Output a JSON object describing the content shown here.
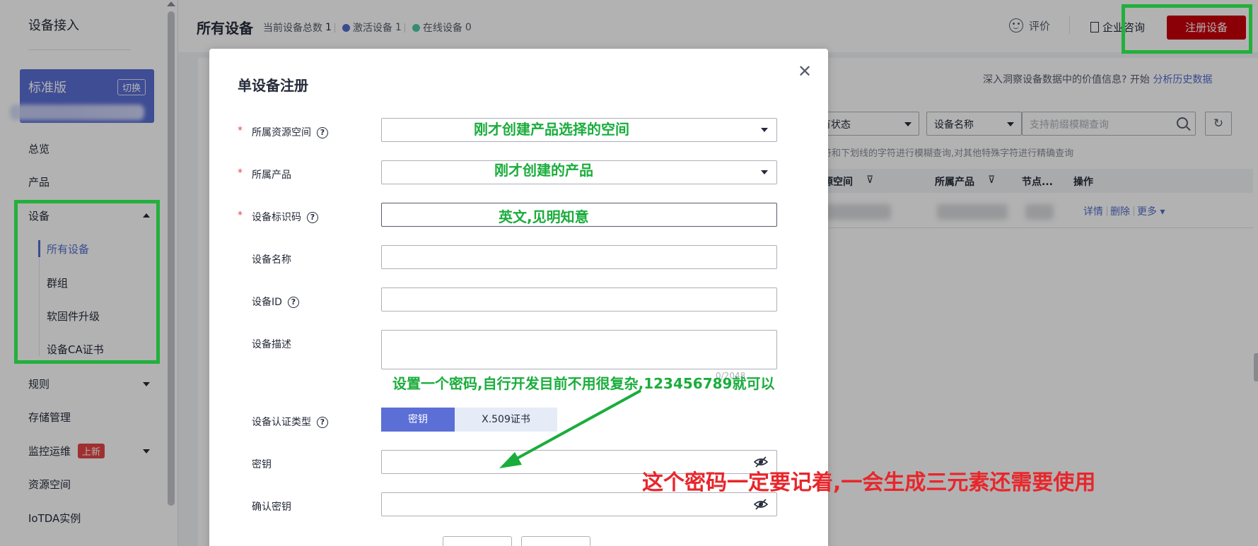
{
  "sidebar": {
    "brand": "设备接入",
    "edition": "标准版",
    "switch_label": "切换",
    "items": {
      "overview": "总览",
      "product": "产品",
      "device": "设备",
      "all_devices": "所有设备",
      "group": "群组",
      "firmware": "软固件升级",
      "ca_cert": "设备CA证书",
      "rules": "规则",
      "storage": "存储管理",
      "monitor": "监控运维",
      "monitor_badge": "上新",
      "resource_space": "资源空间",
      "iotda_instance": "IoTDA实例"
    }
  },
  "header": {
    "title": "所有设备",
    "total_label": "当前设备总数",
    "total_value": "1",
    "active_label": "激活设备",
    "active_value": "1",
    "online_label": "在线设备",
    "online_value": "0",
    "rate_label": "评价",
    "consult_label": "企业咨询",
    "register_button": "注册设备",
    "colors": {
      "active_dot": "#526ecc",
      "online_dot": "#50c8a8",
      "brand_red": "#c7000b"
    }
  },
  "content": {
    "insight_text": "深入洞察设备数据中的价值信息? 开始",
    "insight_link": "分析历史数据",
    "status_filter": "有状态",
    "name_filter": "设备名称",
    "search_placeholder": "支持前缀模糊查询",
    "hint_text": "字符和下划线的字符进行模糊查询,对其他特殊字符进行精确查询",
    "columns": {
      "resource_space": "资源空间",
      "product": "所属产品",
      "node": "节点...",
      "operations": "操作"
    },
    "row_ops": {
      "detail": "详情",
      "delete": "删除",
      "more": "更多"
    }
  },
  "modal": {
    "title": "单设备注册",
    "fields": {
      "resource_space": "所属资源空间",
      "product": "所属产品",
      "node_id": "设备标识码",
      "device_name": "设备名称",
      "device_id": "设备ID",
      "description": "设备描述",
      "auth_type": "设备认证类型",
      "secret": "密钥",
      "confirm_secret": "确认密钥"
    },
    "description_counter": "0/2048",
    "auth_options": {
      "secret": "密钥",
      "x509": "X.509证书"
    }
  },
  "annotations": {
    "resource_space_note": "刚才创建产品选择的空间",
    "product_note": "刚才创建的产品",
    "node_id_note": "英文,见明知意",
    "password_note": "设置一个密码,自行开发目前不用很复杂,123456789就可以",
    "remember_note": "这个密码一定要记着,一会生成三元素还需要使用"
  }
}
